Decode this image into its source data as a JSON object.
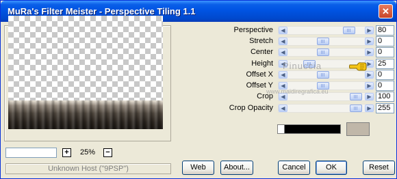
{
  "window": {
    "title": "MuRa's Filter Meister - Perspective Tiling 1.1"
  },
  "zoom": {
    "value": "25%",
    "minus_label": "−",
    "plus_label": "+"
  },
  "status_text": "Unknown Host (\"9PSP\")",
  "parameters": [
    {
      "label": "Perspective",
      "value": "80"
    },
    {
      "label": "Stretch",
      "value": "0"
    },
    {
      "label": "Center",
      "value": "0"
    },
    {
      "label": "Height",
      "value": "25"
    },
    {
      "label": "Offset X",
      "value": "0"
    },
    {
      "label": "Offset Y",
      "value": "0"
    },
    {
      "label": "Crop",
      "value": "100"
    },
    {
      "label": "Crop Opacity",
      "value": "255"
    }
  ],
  "watermark": {
    "line1": "Pinuccia",
    "line2": "www.maidiregrafica.eu"
  },
  "colors": {
    "swatch": "#C0B7A9",
    "accent": "#0054E3"
  },
  "buttons": {
    "web": "Web",
    "about": "About...",
    "cancel": "Cancel",
    "ok": "OK",
    "reset": "Reset"
  }
}
